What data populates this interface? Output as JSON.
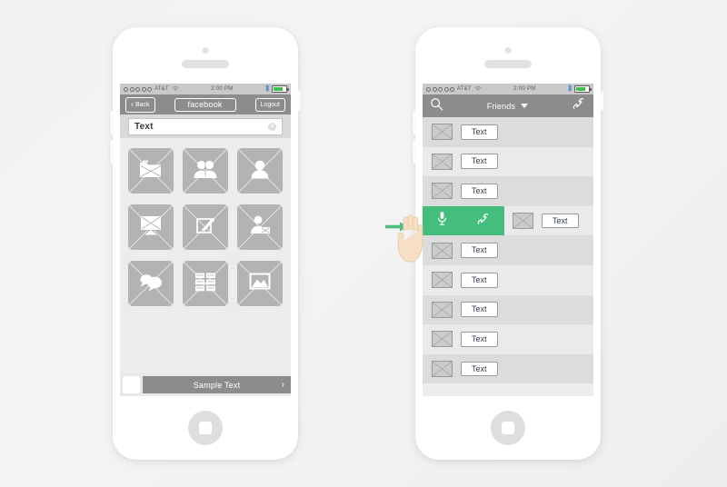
{
  "meta": {
    "title": "Mobile App Wireframe Mockup — Contacts & Swipe Actions",
    "background": "#f2f2f2",
    "accent_green": "#45bd7d",
    "chrome_gray": "#8c8c8c",
    "tile_gray": "#b3b3b3"
  },
  "statusbar": {
    "signal_dots": 5,
    "carrier": "AT&T",
    "wifi_icon": "wifi-icon",
    "time": "2:00 PM",
    "bluetooth_icon": "bluetooth-icon",
    "battery_icon": "battery-icon",
    "battery_level": "80"
  },
  "left_phone": {
    "name": "phone-left",
    "navbar": {
      "back_label": "Back",
      "back_icon": "chevron-left-icon",
      "title_label": "facebook",
      "logout_label": "Logout"
    },
    "search": {
      "value": "Text",
      "placeholder": "Text",
      "clear_icon": "clear-circle-icon",
      "clear_glyph": "✕"
    },
    "grid": [
      {
        "icon": "folder-icon",
        "label": "Folder"
      },
      {
        "icon": "group-users-icon",
        "label": "Groups"
      },
      {
        "icon": "user-profile-icon",
        "label": "Profile"
      },
      {
        "icon": "monitor-icon",
        "label": "Screen"
      },
      {
        "icon": "edit-square-icon",
        "label": "Edit"
      },
      {
        "icon": "person-media-icon",
        "label": "Media Person"
      },
      {
        "icon": "chat-bubbles-icon",
        "label": "Messages"
      },
      {
        "icon": "grid-table-icon",
        "label": "Table"
      },
      {
        "icon": "photo-image-icon",
        "label": "Photos"
      }
    ],
    "bottombar": {
      "thumbnail": "thumbnail-placeholder",
      "label": "Sample Text",
      "chevron_icon": "chevron-right-icon",
      "chevron_glyph": "›"
    }
  },
  "right_phone": {
    "name": "phone-right",
    "navbar": {
      "search_icon": "search-icon",
      "title_label": "Friends",
      "dropdown_icon": "chevron-down-icon",
      "call_icon": "phone-handset-icon"
    },
    "swipe_actions": {
      "mic_icon": "microphone-icon",
      "call_icon": "phone-handset-icon"
    },
    "gesture": {
      "hand_icon": "swipe-hand-icon",
      "arrow_icon": "arrow-right-icon"
    },
    "rows": [
      {
        "avatar": "avatar-placeholder",
        "button_label": "Text",
        "shade": "a",
        "swiped": false
      },
      {
        "avatar": "avatar-placeholder",
        "button_label": "Text",
        "shade": "b",
        "swiped": false
      },
      {
        "avatar": "avatar-placeholder",
        "button_label": "Text",
        "shade": "a",
        "swiped": false
      },
      {
        "avatar": "avatar-placeholder",
        "button_label": "Text",
        "shade": "b",
        "swiped": true
      },
      {
        "avatar": "avatar-placeholder",
        "button_label": "Text",
        "shade": "a",
        "swiped": false
      },
      {
        "avatar": "avatar-placeholder",
        "button_label": "Text",
        "shade": "b",
        "swiped": false
      },
      {
        "avatar": "avatar-placeholder",
        "button_label": "Text",
        "shade": "a",
        "swiped": false
      },
      {
        "avatar": "avatar-placeholder",
        "button_label": "Text",
        "shade": "b",
        "swiped": false
      },
      {
        "avatar": "avatar-placeholder",
        "button_label": "Text",
        "shade": "a",
        "swiped": false
      }
    ]
  }
}
